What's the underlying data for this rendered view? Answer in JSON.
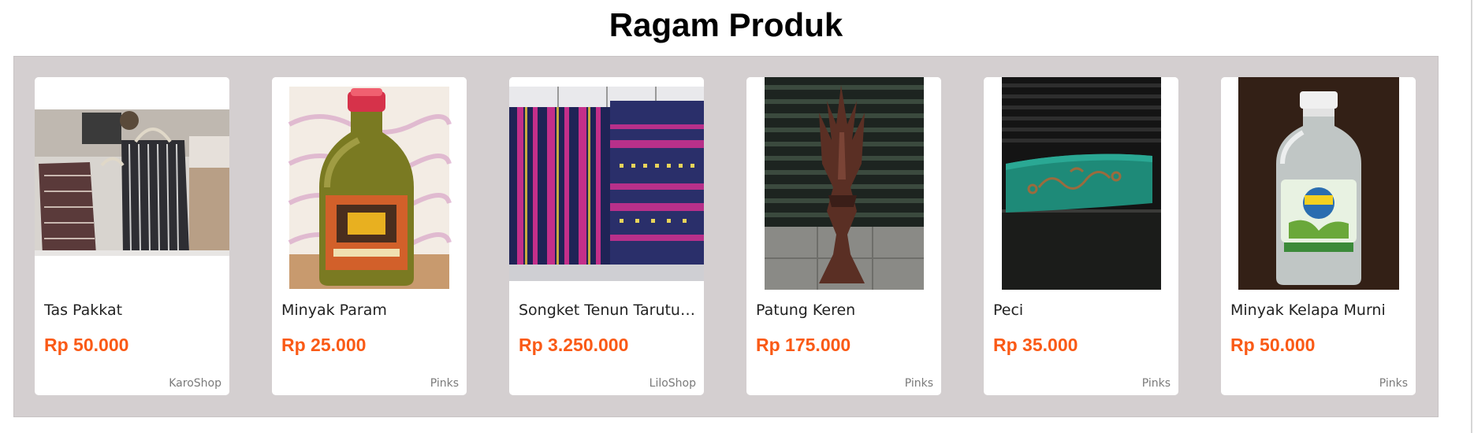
{
  "section": {
    "title": "Ragam Produk"
  },
  "products": [
    {
      "name": "Tas Pakkat",
      "price": "Rp 50.000",
      "shop": "KaroShop",
      "image": "woven-basket-photo"
    },
    {
      "name": "Minyak Param",
      "price": "Rp 25.000",
      "shop": "Pinks",
      "image": "oil-bottle-photo"
    },
    {
      "name": "Songket Tenun Tarutung",
      "price": "Rp 3.250.000",
      "shop": "LiloShop",
      "image": "woven-cloth-photo"
    },
    {
      "name": "Patung Keren",
      "price": "Rp 175.000",
      "shop": "Pinks",
      "image": "wood-statue-photo"
    },
    {
      "name": "Peci",
      "price": "Rp 35.000",
      "shop": "Pinks",
      "image": "cap-photo"
    },
    {
      "name": "Minyak Kelapa Murni",
      "price": "Rp 50.000",
      "shop": "Pinks",
      "image": "coconut-oil-bottle-photo"
    }
  ],
  "colors": {
    "price": "#fa5a16",
    "panel": "#d4cfd0",
    "card": "#ffffff"
  }
}
